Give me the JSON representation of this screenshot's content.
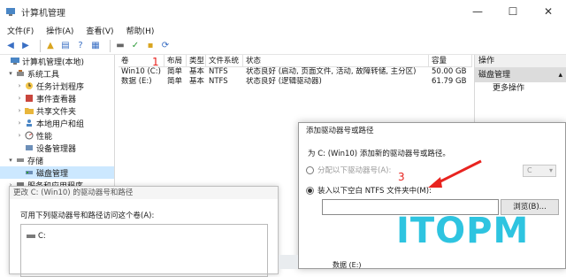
{
  "window": {
    "title": "计算机管理",
    "controls": [
      "—",
      "☐",
      "✕"
    ]
  },
  "menu": [
    "文件(F)",
    "操作(A)",
    "查看(V)",
    "帮助(H)"
  ],
  "tree": {
    "items": [
      {
        "label": "计算机管理(本地)",
        "indent": 0,
        "twisty": "",
        "icon": "computer-icon"
      },
      {
        "label": "系统工具",
        "indent": 1,
        "twisty": "▾",
        "icon": "tools-icon"
      },
      {
        "label": "任务计划程序",
        "indent": 2,
        "twisty": "›",
        "icon": "clock-icon"
      },
      {
        "label": "事件查看器",
        "indent": 2,
        "twisty": "›",
        "icon": "event-icon"
      },
      {
        "label": "共享文件夹",
        "indent": 2,
        "twisty": "›",
        "icon": "folder-icon"
      },
      {
        "label": "本地用户和组",
        "indent": 2,
        "twisty": "›",
        "icon": "users-icon"
      },
      {
        "label": "性能",
        "indent": 2,
        "twisty": "›",
        "icon": "performance-icon"
      },
      {
        "label": "设备管理器",
        "indent": 2,
        "twisty": "",
        "icon": "device-icon"
      },
      {
        "label": "存储",
        "indent": 1,
        "twisty": "▾",
        "icon": "storage-icon"
      },
      {
        "label": "磁盘管理",
        "indent": 2,
        "twisty": "",
        "icon": "disk-icon",
        "selected": true
      },
      {
        "label": "服务和应用程序",
        "indent": 1,
        "twisty": "›",
        "icon": "services-icon"
      }
    ]
  },
  "volumes": {
    "headers": [
      "卷",
      "布局",
      "类型",
      "文件系统",
      "状态",
      "容量"
    ],
    "rows": [
      [
        "Win10 (C:)",
        "简单",
        "基本",
        "NTFS",
        "状态良好 (启动, 页面文件, 活动, 故障转储, 主分区)",
        "50.00 GB"
      ],
      [
        "数据 (E:)",
        "简单",
        "基本",
        "NTFS",
        "状态良好 (逻辑驱动器)",
        "61.79 GB"
      ]
    ]
  },
  "annotations": {
    "one": "1",
    "three": "3"
  },
  "actions": {
    "header": "操作",
    "section": "磁盘管理",
    "more": "更多操作"
  },
  "dialog_change": {
    "title": "更改 C: (Win10) 的驱动器号和路径",
    "label": "可用下列驱动器号和路径访问这个卷(A):",
    "item": "C:"
  },
  "dialog_add": {
    "title": "添加驱动器号或路径",
    "prompt": "为 C: (Win10) 添加新的驱动器号或路径。",
    "option_letter": "分配以下驱动器号(A):",
    "letter_value": "C",
    "option_folder": "装入以下空白 NTFS 文件夹中(M):",
    "browse": "浏览(B)..."
  },
  "bottom": {
    "label": "数据 (E:)"
  },
  "watermark": "ITOPM",
  "colors": {
    "accent_red": "#e8231f",
    "watermark": "#2ec4e0",
    "selection": "#cce8ff"
  }
}
